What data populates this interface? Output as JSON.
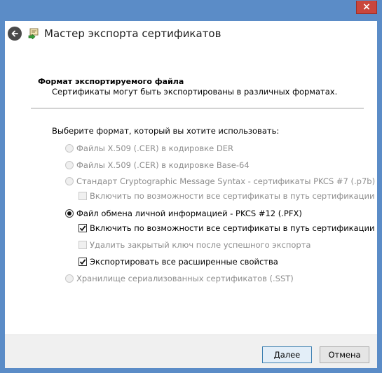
{
  "window": {
    "close_glyph": "×"
  },
  "header": {
    "title": "Мастер экспорта сертификатов",
    "back_icon": "back-arrow-icon",
    "wizard_icon": "certificate-icon"
  },
  "section": {
    "title": "Формат экспортируемого файла",
    "description": "Сертификаты могут быть экспортированы в различных форматах."
  },
  "prompt": "Выберите формат, который вы хотите использовать:",
  "options": {
    "der": {
      "label": "Файлы X.509 (.CER) в кодировке DER",
      "selected": false,
      "enabled": false
    },
    "base64": {
      "label": "Файлы X.509 (.CER) в кодировке Base-64",
      "selected": false,
      "enabled": false
    },
    "pkcs7": {
      "label": "Стандарт Cryptographic Message Syntax - сертификаты PKCS #7 (.p7b)",
      "selected": false,
      "enabled": false
    },
    "pkcs7_include_chain": {
      "label": "Включить по возможности все сертификаты в путь сертификации",
      "checked": false,
      "enabled": false
    },
    "pfx": {
      "label": "Файл обмена личной информацией - PKCS #12 (.PFX)",
      "selected": true,
      "enabled": true
    },
    "pfx_include_chain": {
      "label": "Включить по возможности все сертификаты в путь сертификации",
      "checked": true,
      "enabled": true
    },
    "pfx_delete_key": {
      "label": "Удалить закрытый ключ после успешного экспорта",
      "checked": false,
      "enabled": false
    },
    "pfx_export_props": {
      "label": "Экспортировать все расширенные свойства",
      "checked": true,
      "enabled": true
    },
    "sst": {
      "label": "Хранилище сериализованных сертификатов (.SST)",
      "selected": false,
      "enabled": false
    }
  },
  "buttons": {
    "next": "Далее",
    "cancel": "Отмена"
  },
  "colors": {
    "title_bar": "#5b8cc7",
    "close_button": "#c9463d",
    "disabled_text": "#8d8d8d",
    "primary_border": "#3c7fb1"
  }
}
